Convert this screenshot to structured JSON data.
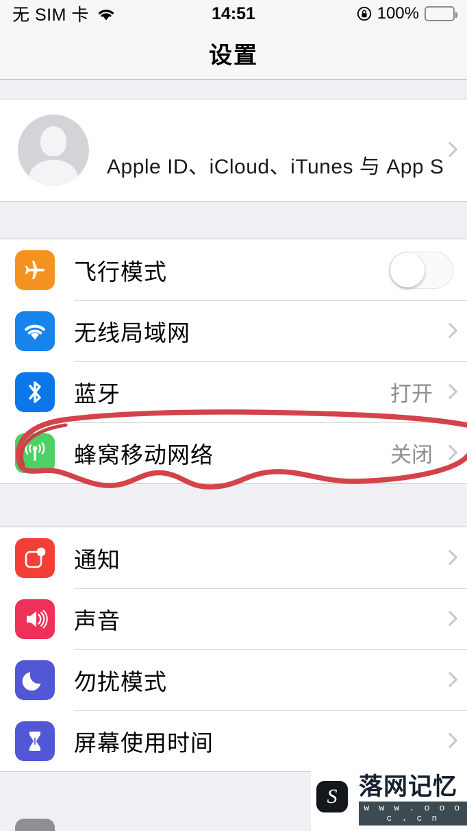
{
  "status_bar": {
    "carrier": "无 SIM 卡",
    "wifi_icon": "wifi-icon",
    "time": "14:51",
    "lock_icon": "rotation-lock-icon",
    "battery_percent": "100%",
    "battery_icon": "battery-full-icon"
  },
  "nav": {
    "title": "设置"
  },
  "apple_id": {
    "name": "",
    "subtitle": "Apple ID、iCloud、iTunes 与 App St...",
    "avatar_icon": "person-avatar-icon",
    "chevron_icon": "chevron-right-icon"
  },
  "groups": [
    {
      "rows": [
        {
          "label": "飞行模式",
          "icon": "airplane-icon",
          "icon_color": "#F59320",
          "accessory": "toggle",
          "toggle_on": false,
          "value": ""
        },
        {
          "label": "无线局域网",
          "icon": "wifi-icon",
          "icon_color": "#1684EB",
          "accessory": "chevron",
          "value": ""
        },
        {
          "label": "蓝牙",
          "icon": "bluetooth-icon",
          "icon_color": "#0A78E8",
          "accessory": "chevron",
          "value": "打开"
        },
        {
          "label": "蜂窝移动网络",
          "icon": "cellular-antenna-icon",
          "icon_color": "#4CD264",
          "accessory": "chevron",
          "value": "关闭"
        }
      ]
    },
    {
      "rows": [
        {
          "label": "通知",
          "icon": "notifications-icon",
          "icon_color": "#F43F36",
          "accessory": "chevron",
          "value": ""
        },
        {
          "label": "声音",
          "icon": "sound-speaker-icon",
          "icon_color": "#EE3158",
          "accessory": "chevron",
          "value": ""
        },
        {
          "label": "勿扰模式",
          "icon": "moon-icon",
          "icon_color": "#5257D6",
          "accessory": "chevron",
          "value": ""
        },
        {
          "label": "屏幕使用时间",
          "icon": "hourglass-icon",
          "icon_color": "#5257D6",
          "accessory": "chevron",
          "value": ""
        }
      ]
    }
  ],
  "annotation": {
    "shape": "hand-drawn-red-oval",
    "color": "#D3434A",
    "targets": "蜂窝移动网络"
  },
  "watermark": {
    "title": "落网记忆",
    "url": "w w w . o o o c . c n",
    "logo_icon": "swirl-s-logo-icon"
  }
}
